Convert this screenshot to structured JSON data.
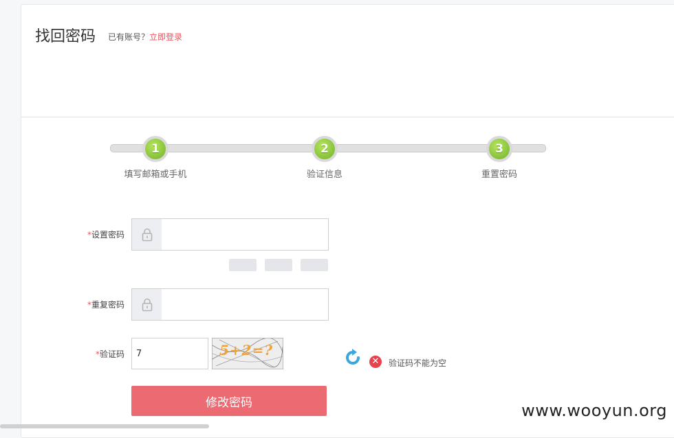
{
  "header": {
    "title": "找回密码",
    "login_prompt": "已有账号？",
    "login_link": "立即登录"
  },
  "steps": [
    {
      "number": "1",
      "label": "填写邮箱或手机"
    },
    {
      "number": "2",
      "label": "验证信息"
    },
    {
      "number": "3",
      "label": "重置密码"
    }
  ],
  "form": {
    "required_mark": "*",
    "password_label": "设置密码",
    "password_value": "",
    "confirm_label": "重复密码",
    "confirm_value": "",
    "captcha_label": "验证码",
    "captcha_value": "7",
    "captcha_image_text": "5+2=?",
    "error_message": "验证码不能为空",
    "submit_label": "修改密码"
  },
  "icons": {
    "lock": "lock-icon",
    "refresh": "refresh-icon",
    "error": "error-icon"
  },
  "colors": {
    "accent": "#ec6a72",
    "step_green": "#8cc63f",
    "link_red": "#e9555f"
  },
  "watermark": "www.wooyun.org"
}
